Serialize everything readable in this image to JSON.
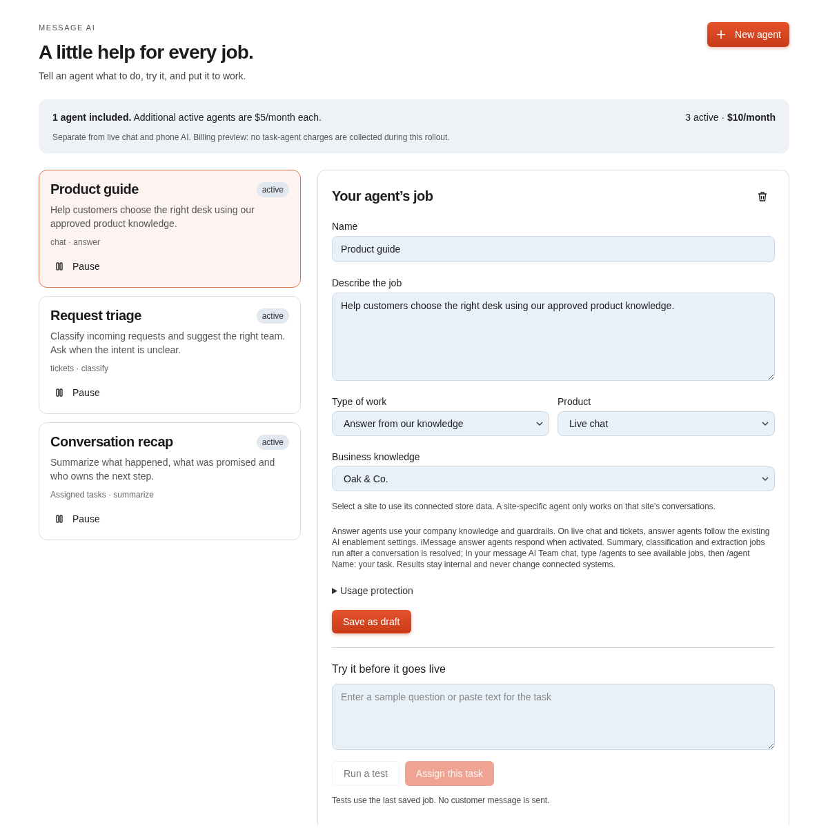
{
  "header": {
    "eyebrow": "MESSAGE AI",
    "title": "A little help for every job.",
    "subtitle": "Tell an agent what to do, try it, and put it to work.",
    "new_button": "New agent"
  },
  "billing": {
    "summary": "**1 agent included.** Additional active agents are $5/month each.",
    "status": "3 active · **$10/month**",
    "note": "Separate from live chat and phone AI. Billing preview: no task-agent charges are collected during this rollout."
  },
  "agents": [
    {
      "name": "Product guide",
      "status": "active",
      "description": "Help customers choose the right desk using our approved product knowledge.",
      "tags": "chat · answer",
      "action": "Pause",
      "selected": true
    },
    {
      "name": "Request triage",
      "status": "active",
      "description": "Classify incoming requests and suggest the right team. Ask when the intent is unclear.",
      "tags": "tickets · classify",
      "action": "Pause",
      "selected": false
    },
    {
      "name": "Conversation recap",
      "status": "active",
      "description": "Summarize what happened, what was promised and who owns the next step.",
      "tags": "Assigned tasks · summarize",
      "action": "Pause",
      "selected": false
    }
  ],
  "editor": {
    "title": "Your agent’s job",
    "name_field": {
      "label": "Name",
      "value": "Product guide"
    },
    "job_field": {
      "label": "Describe the job",
      "value": "Help customers choose the right desk using our approved product knowledge."
    },
    "type_field": {
      "label": "Type of work",
      "value": "Answer from our knowledge"
    },
    "product_field": {
      "label": "Product",
      "value": "Live chat"
    },
    "knowledge_field": {
      "label": "Business knowledge",
      "value": "Oak & Co."
    },
    "site_hint": "Select a site to use its connected store data. A site-specific agent only works on that site's conversations.",
    "info": "Answer agents use your company knowledge and guardrails. On live chat and tickets, answer agents follow the existing AI enablement settings. iMessage answer agents respond when activated. Summary, classification and extraction jobs run after a conversation is resolved; In your message AI Team chat, type /agents to see available jobs, then /agent Name: your task. Results stay internal and never change connected systems.",
    "usage_protection": {
      "label": "Usage protection",
      "expanded": false
    },
    "save_button": "Save as draft",
    "test_title": "Try it before it goes live",
    "test_field": {
      "placeholder": "Enter a sample question or paste text for the task"
    },
    "test_buttons": [
      {
        "kind": "secondary",
        "label": "Run a test",
        "disabled": true
      },
      {
        "kind": "primary",
        "label": "Assign this task",
        "disabled": true
      }
    ],
    "test_note": "Tests use the last saved job. No customer message is sent."
  }
}
